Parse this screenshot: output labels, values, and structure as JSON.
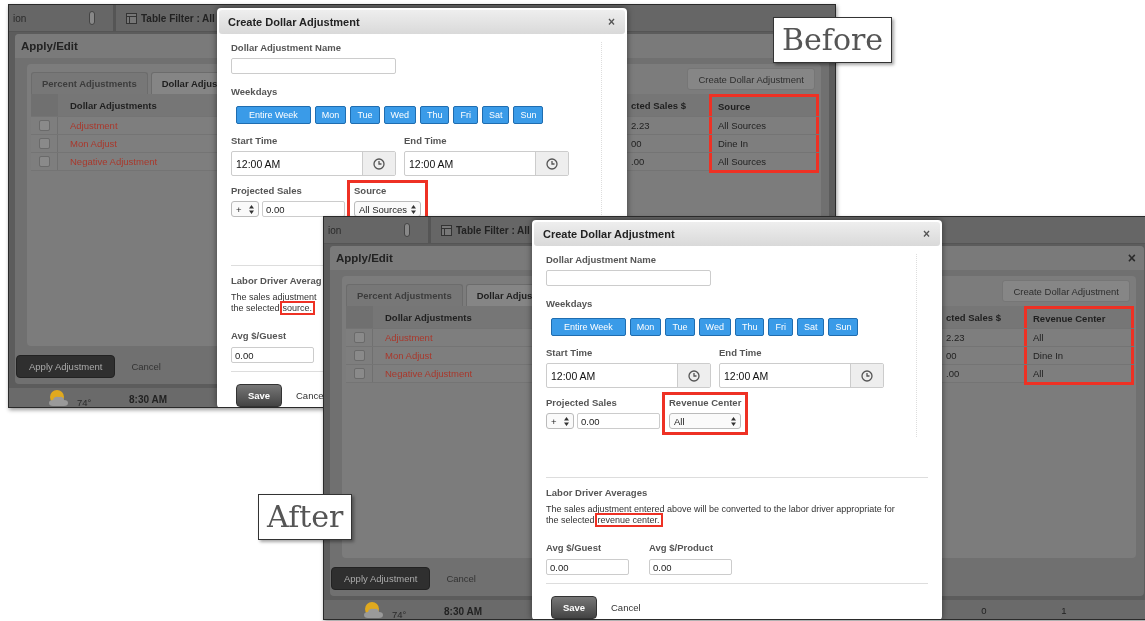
{
  "shots": [
    {
      "kind": "before",
      "label": "Before",
      "app": {
        "topbar": {
          "location": "ion",
          "filter": "Table Filter : All"
        },
        "panel": {
          "title": "Apply/Edit"
        },
        "tabs": [
          {
            "label": "Percent Adjustments",
            "selected": false
          },
          {
            "label": "Dollar Adjus",
            "selected": true
          }
        ],
        "create_button": "Create Dollar Adjustment",
        "table": {
          "columns": [
            {
              "label": "Dollar Adjustments",
              "highlighted": false
            },
            {
              "label": "cted Sales $",
              "highlighted": false
            },
            {
              "label": "Source",
              "highlighted": true
            }
          ],
          "rows": [
            {
              "checked": false,
              "name": "Adjustment",
              "sales": "2.23",
              "source": "All Sources"
            },
            {
              "checked": false,
              "name": "Mon Adjust",
              "sales": "00",
              "source": "Dine In"
            },
            {
              "checked": false,
              "name": "Negative Adjustment",
              "sales": ".00",
              "source": "All Sources"
            }
          ]
        },
        "actions": {
          "apply": "Apply Adjustment",
          "cancel": "Cancel"
        },
        "status": {
          "temperature": "74°",
          "time": "8:30 AM"
        }
      },
      "dialog": {
        "title": "Create Dollar Adjustment",
        "close": "×",
        "name_label": "Dollar Adjustment Name",
        "weekdays_label": "Weekdays",
        "weekdays": [
          {
            "label": "Entire Week",
            "selected": true
          },
          {
            "label": "Mon",
            "selected": true
          },
          {
            "label": "Tue",
            "selected": true
          },
          {
            "label": "Wed",
            "selected": true
          },
          {
            "label": "Thu",
            "selected": true
          },
          {
            "label": "Fri",
            "selected": true
          },
          {
            "label": "Sat",
            "selected": true
          },
          {
            "label": "Sun",
            "selected": true
          }
        ],
        "start_label": "Start Time",
        "start_value": "12:00 AM",
        "end_label": "End Time",
        "end_value": "12:00 AM",
        "sales_label": "Projected Sales",
        "sign": "+",
        "sales_value": "0.00",
        "filter": {
          "label": "Source",
          "value": "All Sources",
          "highlighted": true
        },
        "labor_title": "Labor Driver Averag",
        "note": {
          "lines": [
            "The sales adjustment",
            "the selected"
          ],
          "highlight": "source."
        },
        "averages": [
          {
            "label": "Avg $/Guest",
            "value": "0.00"
          }
        ],
        "save": "Save",
        "cancel": "Cance"
      }
    },
    {
      "kind": "after",
      "label": "After",
      "app": {
        "topbar": {
          "location": "ion",
          "filter": "Table Filter : All"
        },
        "panel": {
          "title": "Apply/Edit",
          "close": "×"
        },
        "tabs": [
          {
            "label": "Percent Adjustments",
            "selected": false
          },
          {
            "label": "Dollar Adjus",
            "selected": true
          }
        ],
        "create_button": "Create Dollar Adjustment",
        "table": {
          "columns": [
            {
              "label": "Dollar Adjustments",
              "highlighted": false
            },
            {
              "label": "cted Sales $",
              "highlighted": false
            },
            {
              "label": "Revenue Center",
              "highlighted": true
            }
          ],
          "rows": [
            {
              "checked": false,
              "name": "Adjustment",
              "sales": "2.23",
              "source": "All"
            },
            {
              "checked": false,
              "name": "Mon Adjust",
              "sales": "00",
              "source": "Dine In"
            },
            {
              "checked": false,
              "name": "Negative Adjustment",
              "sales": ".00",
              "source": "All"
            }
          ]
        },
        "actions": {
          "apply": "Apply Adjustment",
          "cancel": "Cancel"
        },
        "status": {
          "temperature": "74°",
          "time": "8:30 AM",
          "counts": [
            "0",
            "1"
          ]
        }
      },
      "dialog": {
        "title": "Create Dollar Adjustment",
        "close": "×",
        "name_label": "Dollar Adjustment Name",
        "weekdays_label": "Weekdays",
        "weekdays": [
          {
            "label": "Entire Week",
            "selected": true
          },
          {
            "label": "Mon",
            "selected": true
          },
          {
            "label": "Tue",
            "selected": true
          },
          {
            "label": "Wed",
            "selected": true
          },
          {
            "label": "Thu",
            "selected": true
          },
          {
            "label": "Fri",
            "selected": true
          },
          {
            "label": "Sat",
            "selected": true
          },
          {
            "label": "Sun",
            "selected": true
          }
        ],
        "start_label": "Start Time",
        "start_value": "12:00 AM",
        "end_label": "End Time",
        "end_value": "12:00 AM",
        "sales_label": "Projected Sales",
        "sign": "+",
        "sales_value": "0.00",
        "filter": {
          "label": "Revenue Center",
          "value": "All",
          "highlighted": true
        },
        "labor_title": "Labor Driver Averages",
        "note": {
          "lines": [
            "The sales adjustment entered above will be converted to the labor driver appropriate for",
            "the selected"
          ],
          "highlight": "revenue center."
        },
        "averages": [
          {
            "label": "Avg $/Guest",
            "value": "0.00"
          },
          {
            "label": "Avg $/Product",
            "value": "0.00"
          }
        ],
        "save": "Save",
        "cancel": "Cancel"
      }
    }
  ]
}
